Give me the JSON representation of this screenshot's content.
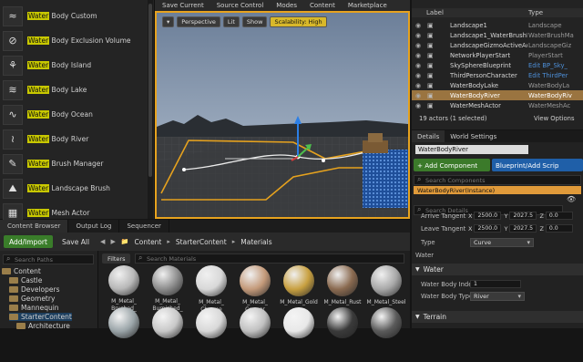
{
  "place_actors": {
    "search_highlight": "Water",
    "items": [
      {
        "prefix": "Water",
        "suffix": " Body Custom",
        "icon": "water-body-custom-icon",
        "glyph": "≈"
      },
      {
        "prefix": "Water",
        "suffix": " Body Exclusion Volume",
        "icon": "water-exclusion-icon",
        "glyph": "⊘"
      },
      {
        "prefix": "Water",
        "suffix": " Body Island",
        "icon": "island-icon",
        "glyph": "⚘"
      },
      {
        "prefix": "Water",
        "suffix": " Body Lake",
        "icon": "lake-icon",
        "glyph": "≋"
      },
      {
        "prefix": "Water",
        "suffix": " Body Ocean",
        "icon": "ocean-icon",
        "glyph": "∿"
      },
      {
        "prefix": "Water",
        "suffix": " Body River",
        "icon": "river-icon",
        "glyph": "≀"
      },
      {
        "prefix": "Water",
        "suffix": " Brush Manager",
        "icon": "brush-manager-icon",
        "glyph": "✎"
      },
      {
        "prefix": "Water",
        "suffix": " Landscape Brush",
        "icon": "landscape-brush-icon",
        "glyph": "⛰"
      },
      {
        "prefix": "Water",
        "suffix": " Mesh Actor",
        "icon": "mesh-actor-icon",
        "glyph": "▦"
      }
    ]
  },
  "toolbar": {
    "items": [
      "Save Current",
      "Source Control",
      "Modes",
      "Content",
      "Marketplace"
    ]
  },
  "viewport": {
    "perspective": "Perspective",
    "lit": "Lit",
    "show": "Show",
    "scalability": "Scalability: High"
  },
  "bottom_tabs": [
    "Content Browser",
    "Output Log",
    "Sequencer"
  ],
  "content_browser": {
    "add_import": "Add/Import",
    "save_all": "Save All",
    "breadcrumb": [
      "Content",
      "StarterContent",
      "Materials"
    ],
    "search_paths_placeholder": "Search Paths",
    "search_materials_placeholder": "Search Materials",
    "filters": "Filters",
    "tree": [
      "Content",
      "Castle",
      "Developers",
      "Geometry",
      "Mannequin",
      "StarterContent",
      "Architecture"
    ],
    "assets": [
      "M_Metal_ Brushed_ Nickel",
      "M_Metal_ Burnished_ Steel",
      "M_Metal_ Chrome",
      "M_Metal_ Copper",
      "M_Metal_Gold",
      "M_Metal_Rust",
      "M_Metal_Steel"
    ]
  },
  "outliner": {
    "col_label": "Label",
    "col_type": "Type",
    "rows": [
      {
        "name": "Landscape1",
        "type": "Landscape"
      },
      {
        "name": "Landscape1_WaterBrushMa",
        "type": "WaterBrushMa"
      },
      {
        "name": "LandscapeGizmoActiveAct",
        "type": "LandscapeGiz"
      },
      {
        "name": "NetworkPlayerStart",
        "type": "PlayerStart"
      },
      {
        "name": "SkySphereBlueprint",
        "type": "Edit BP_Sky_",
        "link": true
      },
      {
        "name": "ThirdPersonCharacter",
        "type": "Edit ThirdPer",
        "link": true
      },
      {
        "name": "WaterBodyLake",
        "type": "WaterBodyLa"
      },
      {
        "name": "WaterBodyRiver",
        "type": "WaterBodyRiv",
        "selected": true
      },
      {
        "name": "WaterMeshActor",
        "type": "WaterMeshAc"
      }
    ],
    "footer": "19 actors (1 selected)",
    "view_options": "View Options"
  },
  "details": {
    "tab_details": "Details",
    "tab_world": "World Settings",
    "actor_name": "WaterBodyRiver",
    "add_component": "+ Add Component",
    "blueprint": "Blueprint/Add Scrip",
    "search_components": "Search Components",
    "instance": "WaterBodyRiver(Instance)",
    "search_details": "Search Details",
    "arrive_label": "Arrive Tangent",
    "arrive": [
      "2500.0",
      "2027.5",
      "0.0"
    ],
    "leave_label": "Leave Tangent",
    "leave": [
      "2500.0",
      "2027.5",
      "0.0"
    ],
    "axes": [
      "X",
      "Y",
      "Z"
    ],
    "type_label": "Type",
    "type_value": "Curve",
    "water_label": "Water",
    "section_water": "Water",
    "body_index_label": "Water Body Index",
    "body_index": "1",
    "body_type_label": "Water Body Type",
    "body_type": "River",
    "section_terrain": "Terrain"
  }
}
